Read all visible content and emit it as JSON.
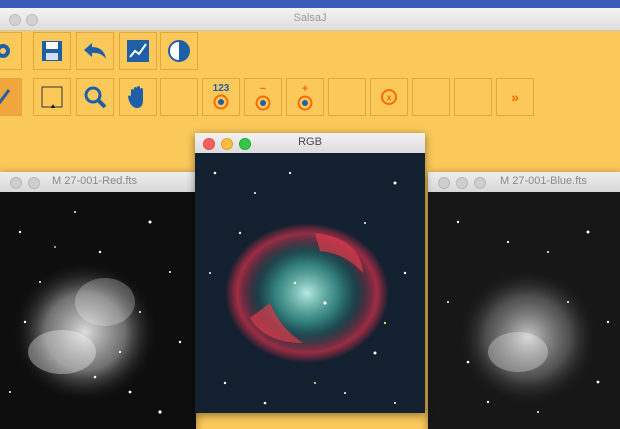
{
  "app": {
    "title": "SalsaJ",
    "colors": {
      "toolbar_bg": "#fbc95a",
      "button_border": "#e0a93c",
      "selected_button": "#f0a63a",
      "icon_blue": "#1f5fa8",
      "accent_orange": "#ff6a00",
      "desktop": "#3d5bb0"
    }
  },
  "toolbar": {
    "row1": [
      {
        "name": "open-icon"
      },
      {
        "name": "save-icon"
      },
      {
        "name": "undo-icon"
      },
      {
        "name": "plot-icon"
      },
      {
        "name": "contrast-icon"
      }
    ],
    "row2": [
      {
        "name": "select-tool-icon"
      },
      {
        "name": "rectangle-tool-icon"
      },
      {
        "name": "zoom-icon"
      },
      {
        "name": "hand-icon"
      },
      {
        "name": "empty-slot"
      },
      {
        "name": "photometry-123-icon",
        "label": "123"
      },
      {
        "name": "photometry-minus-icon",
        "label": "−"
      },
      {
        "name": "photometry-plus-icon",
        "label": "+"
      },
      {
        "name": "empty-slot"
      },
      {
        "name": "photometry-x-icon",
        "label": "x"
      },
      {
        "name": "empty-slot"
      },
      {
        "name": "empty-slot"
      },
      {
        "name": "more-tools-icon",
        "label": "»"
      }
    ]
  },
  "windows": {
    "red": {
      "title": "M 27-001-Red.fts"
    },
    "rgb": {
      "title": "RGB"
    },
    "blue": {
      "title": "M 27-001-Blue.fts"
    }
  }
}
